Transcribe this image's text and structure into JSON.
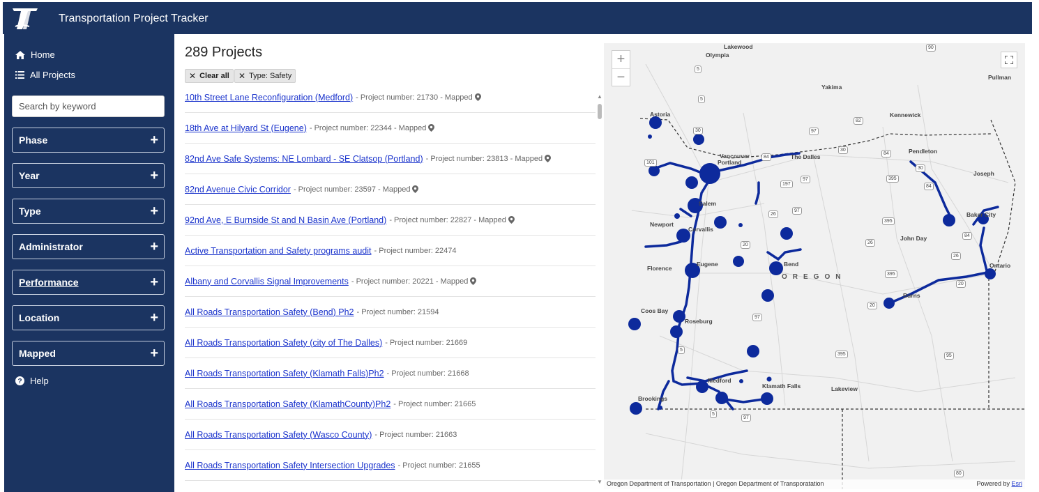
{
  "app": {
    "title": "Transportation Project Tracker"
  },
  "sidebar": {
    "home_label": "Home",
    "all_projects_label": "All Projects",
    "search_placeholder": "Search by keyword",
    "filters": [
      "Phase",
      "Year",
      "Type",
      "Administrator",
      "Performance",
      "Location",
      "Mapped"
    ],
    "help_label": "Help"
  },
  "main": {
    "heading": "289 Projects",
    "chips": {
      "clear_all": "Clear all",
      "type_filter": "Type: Safety"
    },
    "projects": [
      {
        "name": "10th Street Lane Reconfiguration (Medford)",
        "meta": "- Project number: 21730 - Mapped",
        "mapped": true
      },
      {
        "name": "18th Ave at Hilyard St (Eugene)",
        "meta": "- Project number: 22344 - Mapped",
        "mapped": true
      },
      {
        "name": "82nd Ave Safe Systems: NE Lombard - SE Clatsop (Portland)",
        "meta": "- Project number: 23813 - Mapped",
        "mapped": true
      },
      {
        "name": "82nd Avenue Civic Corridor",
        "meta": "- Project number: 23597 - Mapped",
        "mapped": true
      },
      {
        "name": "92nd Ave, E Burnside St and N Basin Ave (Portland)",
        "meta": "- Project number: 22827 - Mapped",
        "mapped": true
      },
      {
        "name": "Active Transportation and Safety programs audit",
        "meta": "- Project number: 22474",
        "mapped": false
      },
      {
        "name": "Albany and Corvallis Signal Improvements",
        "meta": "- Project number: 20221 - Mapped",
        "mapped": true
      },
      {
        "name": "All Roads Transportation Safety (Bend) Ph2",
        "meta": "- Project number: 21594",
        "mapped": false
      },
      {
        "name": "All Roads Transportation Safety (city of The Dalles)",
        "meta": "- Project number: 21669",
        "mapped": false
      },
      {
        "name": "All Roads Transportation Safety (Klamath Falls)Ph2",
        "meta": "- Project number: 21668",
        "mapped": false
      },
      {
        "name": "All Roads Transportation Safety (KlamathCounty)Ph2",
        "meta": "- Project number: 21665",
        "mapped": false
      },
      {
        "name": "All Roads Transportation Safety (Wasco County)",
        "meta": "- Project number: 21663",
        "mapped": false
      },
      {
        "name": "All Roads Transportation Safety Intersection Upgrades",
        "meta": "- Project number: 21655",
        "mapped": false
      }
    ]
  },
  "map": {
    "attribution": "Oregon Department of Transportation | Oregon Department of Transporatation",
    "powered_by": "Powered by",
    "esri": "Esri",
    "labels": [
      "Lakewood",
      "Olympia",
      "Yakima",
      "Pullman",
      "Astoria",
      "Kennewick",
      "Vancouver",
      "Portland",
      "The Dalles",
      "Pendleton",
      "Joseph",
      "Salem",
      "Newport",
      "Corvallis",
      "Baker City",
      "John Day",
      "Florence",
      "Eugene",
      "Bend",
      "OREGON",
      "Ontario",
      "Burns",
      "Coos Bay",
      "Roseburg",
      "Medford",
      "Klamath Falls",
      "Lakeview",
      "Brookings"
    ],
    "shields": [
      "90",
      "5",
      "5",
      "82",
      "97",
      "30",
      "84",
      "30",
      "84",
      "101",
      "84",
      "30",
      "197",
      "97",
      "395",
      "26",
      "97",
      "395",
      "26",
      "20",
      "84",
      "26",
      "20",
      "395",
      "20",
      "97",
      "5",
      "395",
      "95",
      "5",
      "97",
      "80"
    ]
  },
  "colors": {
    "brand_navy": "#1b3461",
    "map_feature": "#0d2a9c",
    "link": "#1a33cc"
  }
}
